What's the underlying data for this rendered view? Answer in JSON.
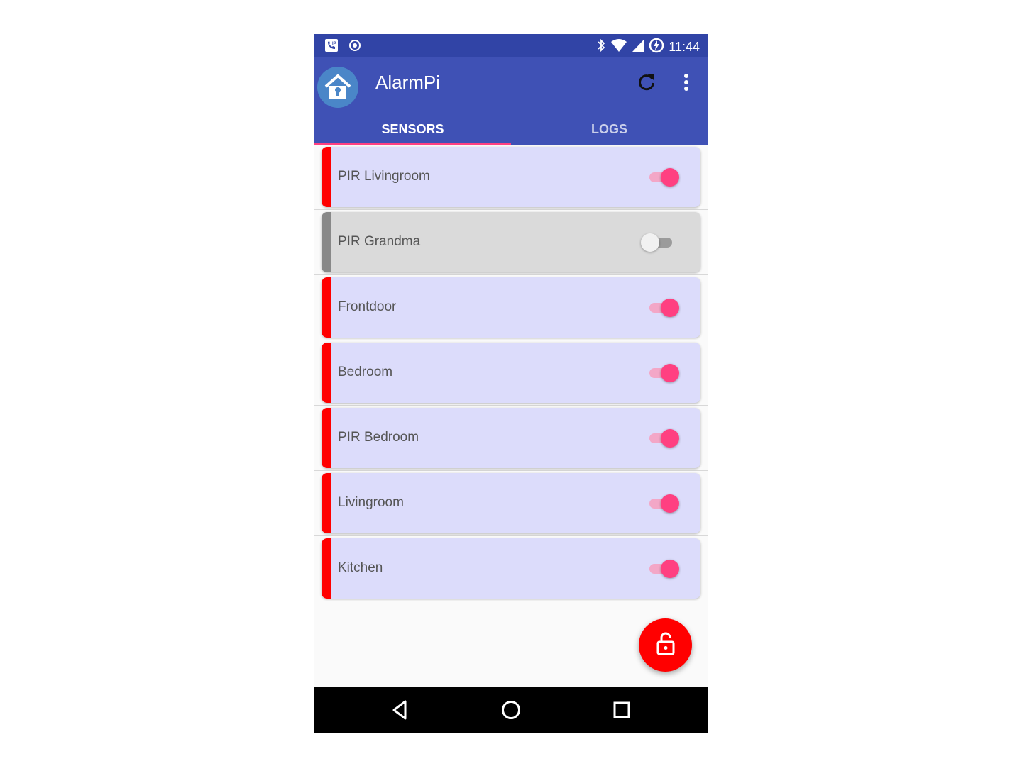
{
  "status_bar": {
    "time": "11:44",
    "icons": [
      "voip-icon",
      "record-icon",
      "bluetooth-icon",
      "wifi-icon",
      "signal-icon",
      "battery-charging-icon"
    ]
  },
  "app_bar": {
    "title": "AlarmPi",
    "logo_icon": "house-lock-icon",
    "actions": [
      "refresh-icon",
      "more-vert-icon"
    ]
  },
  "tabs": [
    {
      "label": "SENSORS",
      "active": true
    },
    {
      "label": "LOGS",
      "active": false
    }
  ],
  "sensors": [
    {
      "name": "PIR Livingroom",
      "enabled": true
    },
    {
      "name": "PIR Grandma",
      "enabled": false
    },
    {
      "name": "Frontdoor",
      "enabled": true
    },
    {
      "name": "Bedroom",
      "enabled": true
    },
    {
      "name": "PIR Bedroom",
      "enabled": true
    },
    {
      "name": "Livingroom",
      "enabled": true
    },
    {
      "name": "Kitchen",
      "enabled": true
    }
  ],
  "fab": {
    "icon": "unlock-icon"
  },
  "nav_bar": [
    "back-icon",
    "home-icon",
    "recents-icon"
  ],
  "colors": {
    "primary": "#3f51b5",
    "primary_dark": "#3144a6",
    "accent": "#ff4081",
    "enabled_stripe": "#ff0000",
    "disabled_stripe": "#888888",
    "enabled_card": "#dcdcfb",
    "disabled_card": "#dadada",
    "fab": "#ff0000"
  }
}
